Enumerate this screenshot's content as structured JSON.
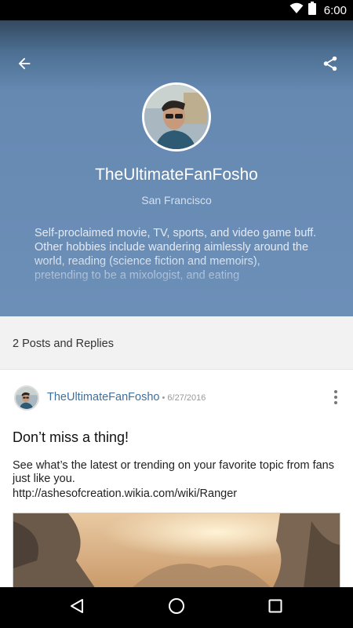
{
  "status_bar": {
    "time": "6:00"
  },
  "profile": {
    "username": "TheUltimateFanFosho",
    "location": "San Francisco",
    "bio": "Self-proclaimed movie, TV, sports, and video game buff. Other hobbies include wandering aimlessly around the world, reading (science fiction and memoirs), pretending to be a mixologist, and eating"
  },
  "posts_header": {
    "count_label": "2 Posts and Replies"
  },
  "post": {
    "author": "TheUltimateFanFosho",
    "date": " • 6/27/2016",
    "title": "Don’t miss a thing!",
    "body": "See what’s the latest or trending on your favorite topic from fans just like you.",
    "link": "http://ashesofcreation.wikia.com/wiki/Ranger"
  },
  "colors": {
    "header_bg": "#6c8fb8",
    "author_link": "#3e6f9e",
    "section_bg": "#f2f2f2"
  },
  "icons": [
    "wifi-icon",
    "battery-icon",
    "back-arrow-icon",
    "share-icon",
    "more-vert-icon",
    "nav-back-icon",
    "nav-home-icon",
    "nav-recents-icon"
  ]
}
